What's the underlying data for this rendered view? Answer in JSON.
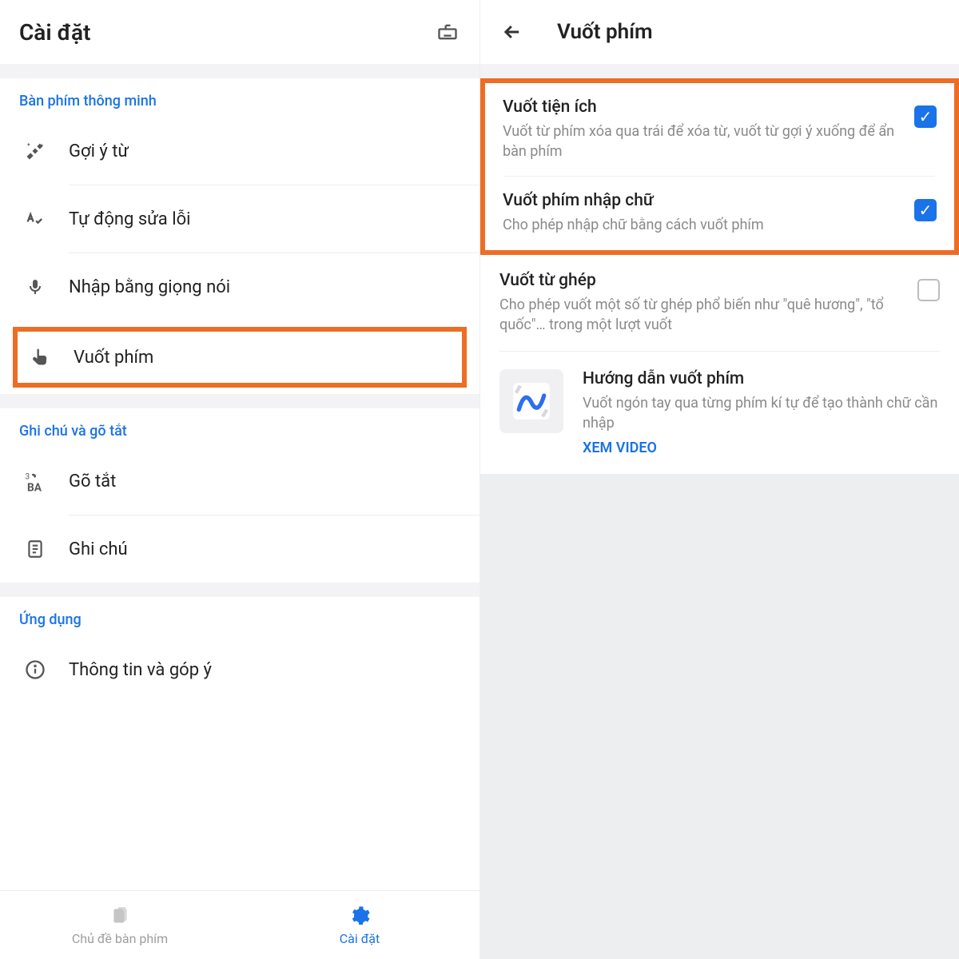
{
  "left": {
    "title": "Cài đặt",
    "sections": [
      {
        "label": "Bàn phím thông minh",
        "items": [
          "Gợi ý từ",
          "Tự động sửa lỗi",
          "Nhập bằng giọng nói",
          "Vuốt phím"
        ]
      },
      {
        "label": "Ghi chú và gõ tắt",
        "items": [
          "Gõ tắt",
          "Ghi chú"
        ]
      },
      {
        "label": "Ứng dụng",
        "items": [
          "Thông tin và góp ý"
        ]
      }
    ],
    "tabs": [
      {
        "label": "Chủ đề bàn phím",
        "active": false
      },
      {
        "label": "Cài đặt",
        "active": true
      }
    ]
  },
  "right": {
    "title": "Vuốt phím",
    "items": [
      {
        "title": "Vuốt tiện ích",
        "desc": "Vuốt từ phím xóa qua trái để xóa từ, vuốt từ gợi ý xuống để ẩn bàn phím",
        "checked": true
      },
      {
        "title": "Vuốt phím nhập chữ",
        "desc": "Cho phép nhập chữ bằng cách vuốt phím",
        "checked": true
      },
      {
        "title": "Vuốt từ ghép",
        "desc": "Cho phép vuốt một số từ ghép phổ biến như \"quê hương\", \"tổ quốc\"… trong một lượt vuốt",
        "checked": false
      }
    ],
    "guide": {
      "title": "Hướng dẫn vuốt phím",
      "desc": "Vuốt ngón tay qua từng phím kí tự để tạo thành chữ cần nhập",
      "link": "XEM VIDEO"
    }
  }
}
